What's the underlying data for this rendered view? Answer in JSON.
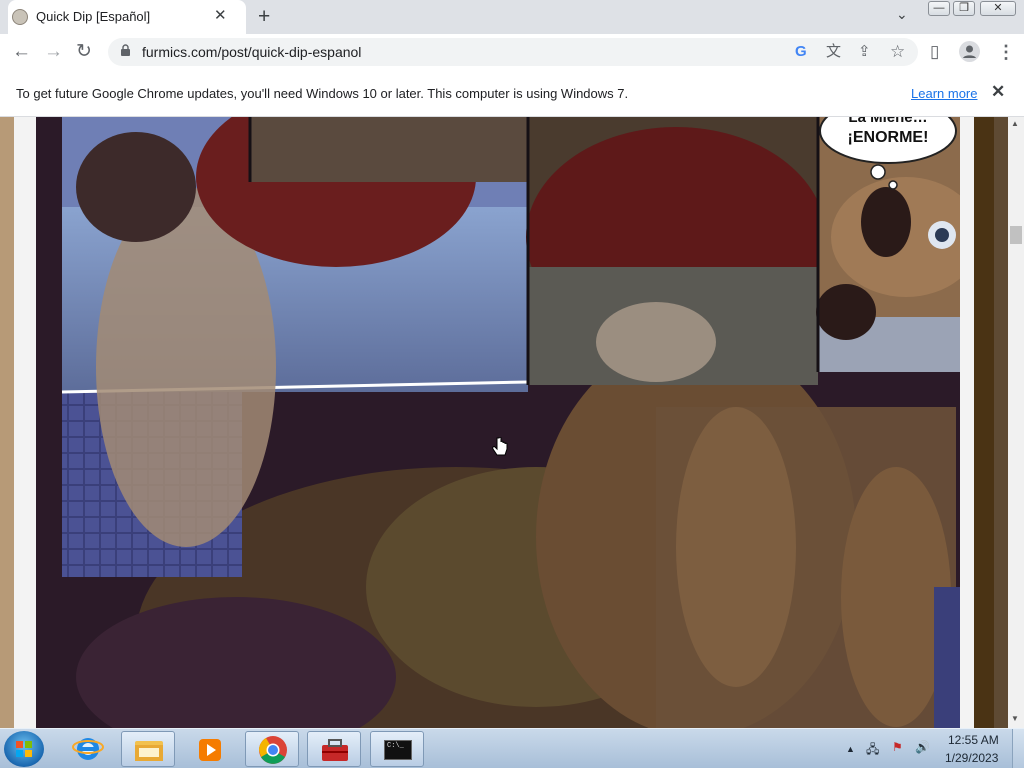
{
  "tab": {
    "title": "Quick Dip [Español]",
    "close": "✕"
  },
  "toolbar": {
    "new_tab": "+",
    "tab_search": "⌄"
  },
  "window": {
    "minimize": "—",
    "restore": "❐",
    "close": "✕"
  },
  "nav": {
    "back": "←",
    "forward": "→",
    "reload": "↻"
  },
  "address": {
    "url": "furmics.com/post/quick-dip-espanol"
  },
  "omnibox_icons": {
    "google": "G",
    "translate": "文",
    "share": "⇪",
    "bookmark": "☆",
    "side_panel": "▯",
    "profile": "●",
    "menu": "⋮"
  },
  "infobar": {
    "message": "To get future Google Chrome updates, you'll need Windows 10 or later. This computer is using Windows 7.",
    "link": "Learn more",
    "close": "✕"
  },
  "comic": {
    "speech_bubble_lines": [
      "La Miene…",
      "¡ENORME!"
    ]
  },
  "taskbar": {
    "items": [
      "internet-explorer",
      "file-explorer",
      "media-player",
      "chrome",
      "toolbox",
      "command-prompt"
    ],
    "cmd_label": "C:\\_"
  },
  "clock": {
    "time": "12:55 AM",
    "date": "1/29/2023"
  },
  "tray": {
    "expand": "▲",
    "network": "🖧",
    "flag": "⚑",
    "volume": "🔊"
  },
  "scroll": {
    "up": "▲",
    "down": "▼"
  }
}
